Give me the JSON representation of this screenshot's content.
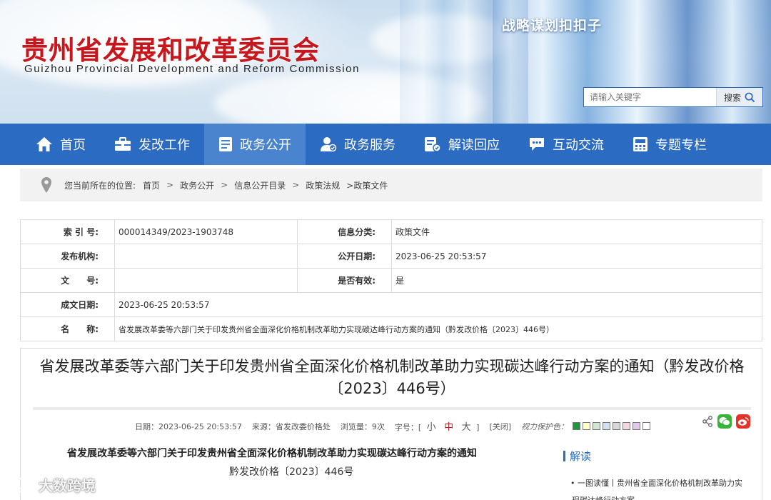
{
  "header": {
    "title_cn": "贵州省发展和改革委员会",
    "title_en": "Guizhou Provincial Development and Reform Commission",
    "slogan": "战略谋划扣扣子",
    "search": {
      "placeholder": "请输入关键字",
      "button_label": "搜索",
      "icon": "search-icon"
    }
  },
  "nav": {
    "items": [
      {
        "label": "首页",
        "icon": "home-icon",
        "active": false
      },
      {
        "label": "发改工作",
        "icon": "briefcase-icon",
        "active": false
      },
      {
        "label": "政务公开",
        "icon": "document-icon",
        "active": true
      },
      {
        "label": "政务服务",
        "icon": "user-service-icon",
        "active": false
      },
      {
        "label": "解读回应",
        "icon": "edit-document-icon",
        "active": false
      },
      {
        "label": "互动交流",
        "icon": "chat-icon",
        "active": false
      },
      {
        "label": "专题专栏",
        "icon": "calculator-icon",
        "active": false
      }
    ]
  },
  "breadcrumb": {
    "prefix": "您当前所在的位置:",
    "items": [
      "首页",
      "政务公开",
      "信息公开目录",
      "政策法规",
      ">政策文件"
    ]
  },
  "info_table": {
    "index_label": "索 引 号:",
    "index_value": "000014349/2023-1903748",
    "category_label": "信息分类:",
    "category_value": "政策文件",
    "publisher_label": "发布机构:",
    "publisher_value": "",
    "publish_date_label": "公开日期:",
    "publish_date_value": "2023-06-25 20:53:57",
    "doc_no_label": "文　　号:",
    "doc_no_value": "",
    "valid_label": "是否有效:",
    "valid_value": "是",
    "created_label": "成文日期:",
    "created_value": "2023-06-25 20:53:57",
    "name_label": "名　　称:",
    "name_value": "省发展改革委等六部门关于印发贵州省全面深化价格机制改革助力实现碳达峰行动方案的通知（黔发改价格〔2023〕446号）"
  },
  "article": {
    "title": "省发展改革委等六部门关于印发贵州省全面深化价格机制改革助力实现碳达峰行动方案的通知（黔发改价格〔2023〕446号）",
    "meta": {
      "date": "日期：2023-06-25 20:53:57",
      "source": "来源：省发改委价格处",
      "views": "浏览量：9次",
      "font_label": "字号：[",
      "font_small": "小",
      "font_mid": "中",
      "font_big": "大",
      "font_end": "]",
      "close": "[关闭]",
      "eye_care": "视力保护色："
    },
    "swatch_colors": [
      "#1a9a3a",
      "#ffffc8",
      "#cfe8cf",
      "#cfe0f0",
      "#d8d8d8",
      "#f6d6e0",
      "#e0c8f0",
      "#ffffff"
    ],
    "doc_title": "省发展改革委等六部门关于印发贵州省全面深化价格机制改革助力实现碳达峰行动方案的通知",
    "doc_no": "黔发改价格〔2023〕446号",
    "share_icons": [
      "share-icon",
      "wechat-icon",
      "weibo-icon"
    ]
  },
  "sidebar": {
    "heading": "解读",
    "items": [
      "一图读懂丨贵州省全面深化价格机制改革助力实现碳达峰行动方案"
    ]
  },
  "watermark": {
    "text": "大数跨境"
  }
}
